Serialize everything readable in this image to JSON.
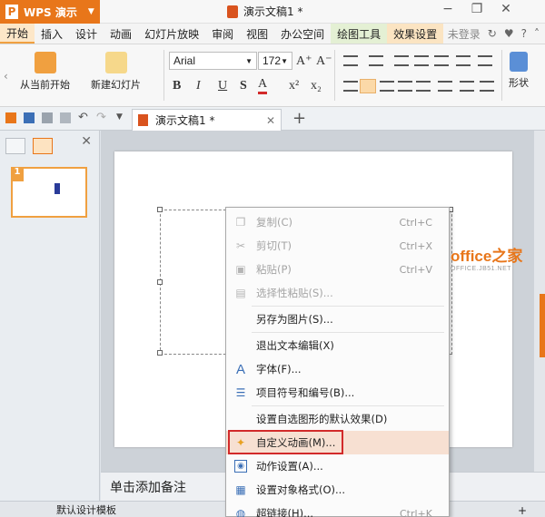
{
  "app": {
    "name": "WPS 演示",
    "document_title": "演示文稿1 *",
    "colors": {
      "brand": "#e8761a",
      "highlight": "#f7e0d2",
      "annotation": "#d22a2a"
    }
  },
  "menubar": {
    "items": [
      "开始",
      "插入",
      "设计",
      "动画",
      "幻灯片放映",
      "审阅",
      "视图",
      "办公空间",
      "绘图工具",
      "效果设置"
    ],
    "login_label": "未登录"
  },
  "ribbon": {
    "play_from_current": "从当前开始",
    "new_slide": "新建幻灯片",
    "font_name": "Arial",
    "font_size": "172",
    "shape_label": "形状",
    "format_glyphs": {
      "bold": "B",
      "italic": "I",
      "underline": "U",
      "shadow": "S",
      "color": "A",
      "super": "x²",
      "sub": "x₂"
    }
  },
  "tabs": {
    "doc_tab": "演示文稿1 *"
  },
  "slides": {
    "thumb_number": "1"
  },
  "notes": {
    "placeholder": "单击添加备注"
  },
  "status": {
    "template": "默认设计模板",
    "zoom_plus": "+"
  },
  "watermark": {
    "big": "office之家",
    "small": "OFFICE.JB51.NET"
  },
  "context_menu": {
    "items": [
      {
        "label": "复制(C)",
        "shortcut": "Ctrl+C",
        "icon": "copy-icon",
        "disabled": true
      },
      {
        "label": "剪切(T)",
        "shortcut": "Ctrl+X",
        "icon": "cut-icon",
        "disabled": true
      },
      {
        "label": "粘贴(P)",
        "shortcut": "Ctrl+V",
        "icon": "paste-icon",
        "disabled": true
      },
      {
        "label": "选择性粘贴(S)...",
        "shortcut": "",
        "icon": "paste-special-icon",
        "disabled": true
      },
      {
        "label": "另存为图片(S)...",
        "shortcut": "",
        "icon": "",
        "disabled": false
      },
      {
        "label": "退出文本编辑(X)",
        "shortcut": "",
        "icon": "",
        "disabled": false
      },
      {
        "label": "字体(F)...",
        "shortcut": "",
        "icon": "font-icon",
        "disabled": false
      },
      {
        "label": "项目符号和编号(B)...",
        "shortcut": "",
        "icon": "bullets-icon",
        "disabled": false
      },
      {
        "label": "设置自选图形的默认效果(D)",
        "shortcut": "",
        "icon": "",
        "disabled": false
      },
      {
        "label": "自定义动画(M)...",
        "shortcut": "",
        "icon": "custom-animation-icon",
        "disabled": false,
        "highlighted": true
      },
      {
        "label": "动作设置(A)...",
        "shortcut": "",
        "icon": "action-settings-icon",
        "disabled": false
      },
      {
        "label": "设置对象格式(O)...",
        "shortcut": "",
        "icon": "format-object-icon",
        "disabled": false
      },
      {
        "label": "超链接(H)...",
        "shortcut": "Ctrl+K",
        "icon": "hyperlink-icon",
        "disabled": false
      }
    ]
  }
}
